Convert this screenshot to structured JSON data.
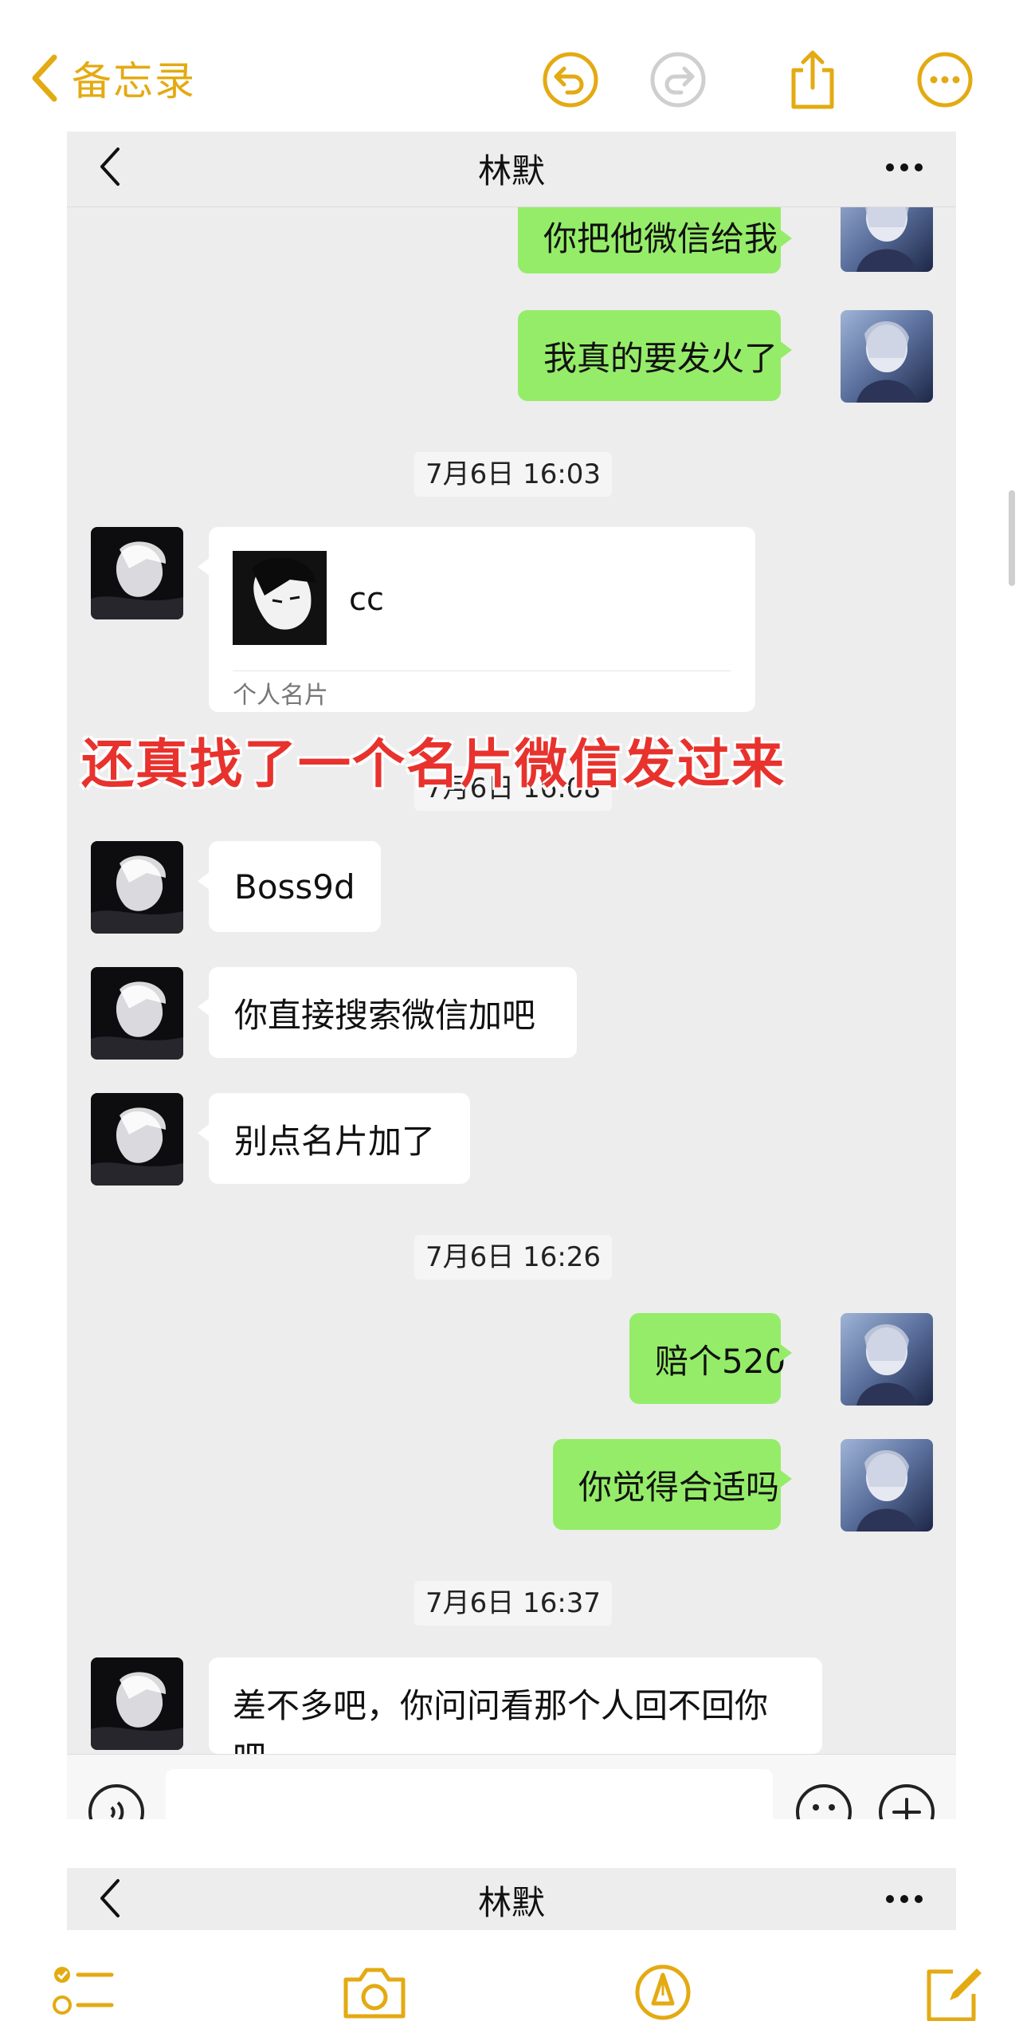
{
  "app": {
    "back_label": "备忘录",
    "accent_color": "#e3aa12",
    "top_icons": [
      "undo-icon",
      "redo-icon",
      "share-icon",
      "more-circle-icon"
    ],
    "bottom_icons": [
      "checklist-icon",
      "camera-icon",
      "markup-pen-icon",
      "compose-icon"
    ]
  },
  "chat": {
    "contact_name": "林默",
    "bubble_colors": {
      "me": "#95ec69",
      "them": "#ffffff",
      "background": "#ededed"
    },
    "messages": [
      {
        "from": "me",
        "text": "你把他微信给我"
      },
      {
        "from": "me",
        "text": "我真的要发火了"
      },
      {
        "type": "time",
        "text": "7月6日 16:03"
      },
      {
        "from": "them",
        "type": "card",
        "name": "cc",
        "card_label": "个人名片"
      },
      {
        "type": "time",
        "text": "7月6日 16:08"
      },
      {
        "from": "them",
        "text": "Boss9d"
      },
      {
        "from": "them",
        "text": "你直接搜索微信加吧"
      },
      {
        "from": "them",
        "text": "别点名片加了"
      },
      {
        "type": "time",
        "text": "7月6日 16:26"
      },
      {
        "from": "me",
        "text": "赔个520"
      },
      {
        "from": "me",
        "text": "你觉得合适吗"
      },
      {
        "type": "time",
        "text": "7月6日 16:37"
      },
      {
        "from": "them",
        "text": "差不多吧，你问问看那个人回不回你吧"
      }
    ],
    "input_icons": [
      "voice-icon",
      "emoji-icon",
      "plus-icon"
    ]
  },
  "caption": "还真找了一个名片微信发过来",
  "caption_color": "#e8322d",
  "chat2": {
    "contact_name": "林默"
  }
}
